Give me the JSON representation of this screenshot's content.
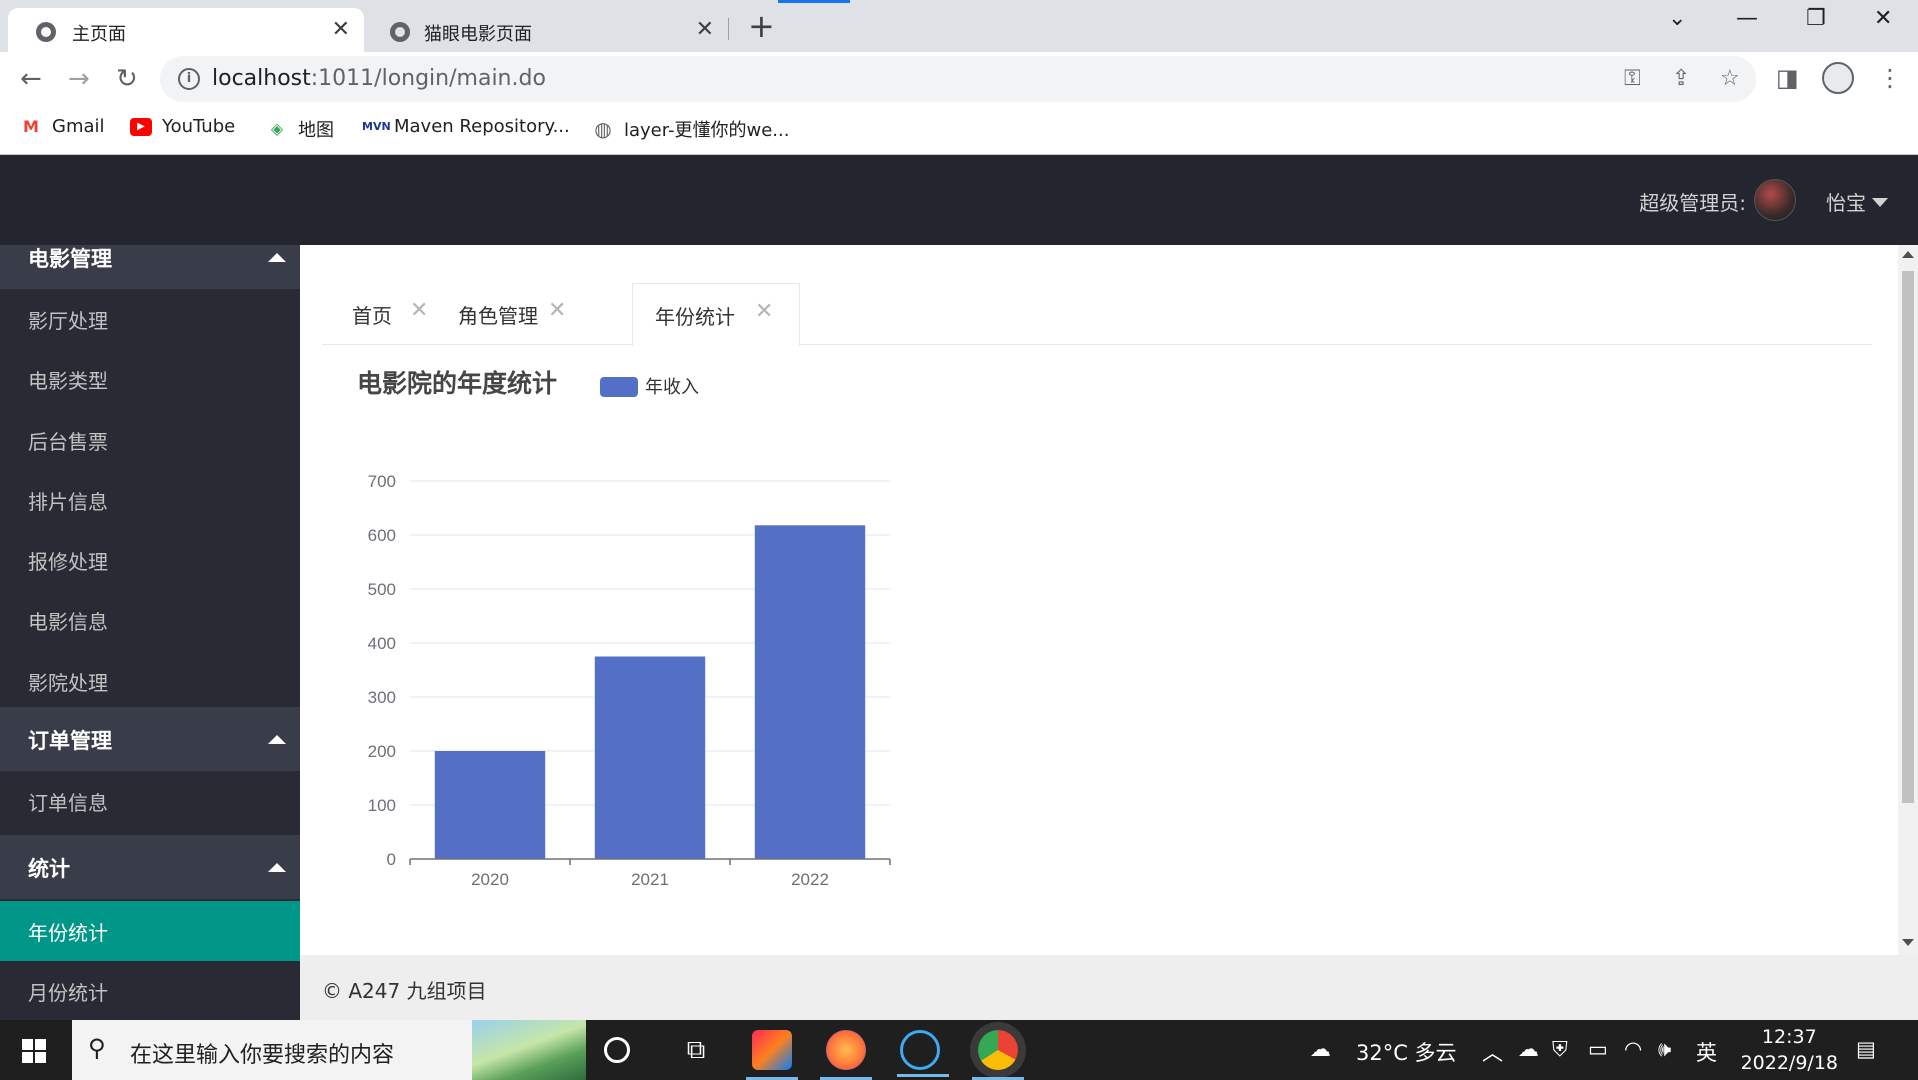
{
  "browser": {
    "tabs": [
      {
        "title": "主页面",
        "close": "✕"
      },
      {
        "title": "猫眼电影页面",
        "close": "✕"
      }
    ],
    "new_tab": "+",
    "address": {
      "host": "localhost",
      "rest": ":1011/longin/main.do"
    },
    "bookmarks": [
      {
        "label": "Gmail",
        "icon": "gmail-icon"
      },
      {
        "label": "YouTube",
        "icon": "youtube-icon"
      },
      {
        "label": "地图",
        "icon": "maps-icon"
      },
      {
        "label": "Maven Repository...",
        "icon": "maven-icon"
      },
      {
        "label": "layer-更懂你的we...",
        "icon": "globe-icon"
      }
    ]
  },
  "header": {
    "admin_label": "超级管理员:",
    "admin_name": "怡宝"
  },
  "sidebar": {
    "group_movie": "电影管理",
    "movie_items": [
      "影厅处理",
      "电影类型",
      "后台售票",
      "排片信息",
      "报修处理",
      "电影信息",
      "影院处理"
    ],
    "group_order": "订单管理",
    "order_items": [
      "订单信息"
    ],
    "group_stats": "统计",
    "stats_items": [
      "年份统计",
      "月份统计"
    ],
    "active_color": "#009688"
  },
  "page_tabs": [
    {
      "label": "首页"
    },
    {
      "label": "角色管理"
    },
    {
      "label": "年份统计"
    }
  ],
  "chart_data": {
    "type": "bar",
    "title": "电影院的年度统计",
    "legend": "年收入",
    "legend_position": "top",
    "categories": [
      "2020",
      "2021",
      "2022"
    ],
    "series": [
      {
        "name": "年收入",
        "values": [
          200,
          375,
          618
        ],
        "color": "#5470c6"
      }
    ],
    "ylim": [
      0,
      700
    ],
    "yticks": [
      0,
      100,
      200,
      300,
      400,
      500,
      600,
      700
    ],
    "grid": true
  },
  "footer": {
    "text": "© A247 九组项目"
  },
  "taskbar": {
    "search_placeholder": "在这里输入你要搜索的内容",
    "weather": "32°C 多云",
    "ime": "英",
    "time": "12:37",
    "date": "2022/9/18"
  }
}
